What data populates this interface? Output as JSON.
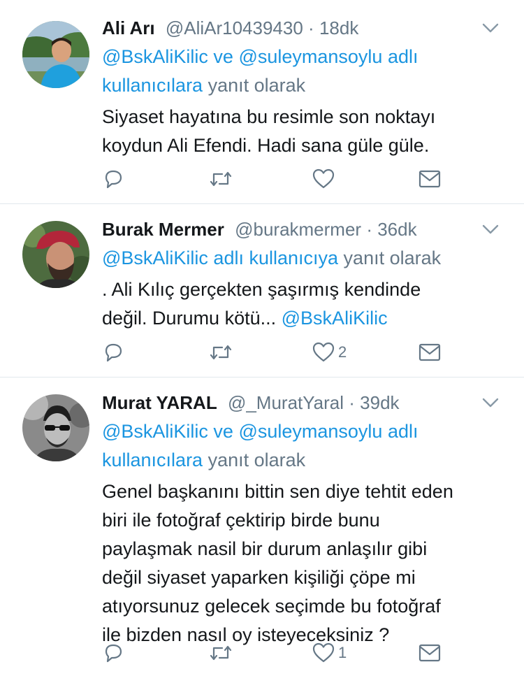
{
  "tweets": [
    {
      "name": "Ali Arı",
      "handle": "@AliAr10439430",
      "separator": "·",
      "time": "18dk",
      "reply_mentions_1": "@BskAliKilic ve @suleymansoylu adlı",
      "reply_mentions_2": "kullanıcılara",
      "reply_suffix": "yanıt olarak",
      "body_lines": [
        "Siyaset hayatına bu resimle son noktayı",
        "koydun Ali Efendi. Hadi sana güle güle."
      ],
      "like_count": "",
      "avatar": "man-outdoors-blue-shirt"
    },
    {
      "name": "Burak Mermer",
      "handle": "@burakmermer",
      "separator": "·",
      "time": "36dk",
      "reply_mentions_1": "@BskAliKilic adlı kullanıcıya",
      "reply_suffix": "yanıt olarak",
      "body_lines": [
        ". Ali Kılıç gerçekten şaşırmış kendinde",
        "değil. Durumu kötü..."
      ],
      "body_mention": "@BskAliKilic",
      "like_count": "2",
      "avatar": "man-red-cap-beard"
    },
    {
      "name": "Murat YARAL",
      "handle": "@_MuratYaral",
      "separator": "·",
      "time": "39dk",
      "reply_mentions_1": "@BskAliKilic ve @suleymansoylu adlı",
      "reply_mentions_2": "kullanıcılara",
      "reply_suffix": "yanıt olarak",
      "body_lines": [
        "Genel başkanını bittin sen diye tehtit eden",
        "biri ile fotoğraf çektirip birde bunu",
        "paylaşmak nasil bir durum anlaşılır gibi",
        "değil siyaset yaparken kişiliği çöpe mi",
        "atıyorsunuz gelecek seçimde bu fotoğraf",
        "ile bizden nasıl oy isteyeceksiniz ?"
      ],
      "like_count": "1",
      "avatar": "man-sunglasses-bw"
    }
  ],
  "icons": {
    "reply": "reply-icon",
    "retweet": "retweet-icon",
    "like": "heart-icon",
    "dm": "envelope-icon",
    "caret": "chevron-down-icon"
  },
  "colors": {
    "link": "#1b95e0",
    "muted": "#657786",
    "text": "#14171a",
    "divider": "#e1e8ed"
  }
}
